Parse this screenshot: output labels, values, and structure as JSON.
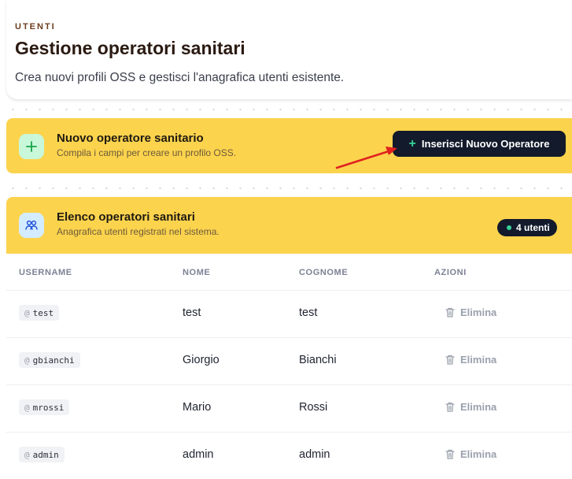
{
  "header": {
    "section_label": "UTENTI",
    "title": "Gestione operatori sanitari",
    "subtitle": "Crea nuovi profili OSS e gestisci l'anagrafica utenti esistente."
  },
  "new_operator": {
    "title": "Nuovo operatore sanitario",
    "subtitle": "Compila i campi per creare un profilo OSS.",
    "button_label": "Inserisci Nuovo Operatore"
  },
  "operators_list": {
    "title": "Elenco operatori sanitari",
    "subtitle": "Anagrafica utenti registrati nel sistema.",
    "count_label": "4 utenti",
    "columns": [
      "USERNAME",
      "NOME",
      "COGNOME",
      "AZIONI"
    ],
    "rows": [
      {
        "username": "test",
        "nome": "test",
        "cognome": "test",
        "action": "Elimina"
      },
      {
        "username": "gbianchi",
        "nome": "Giorgio",
        "cognome": "Bianchi",
        "action": "Elimina"
      },
      {
        "username": "mrossi",
        "nome": "Mario",
        "cognome": "Rossi",
        "action": "Elimina"
      },
      {
        "username": "admin",
        "nome": "admin",
        "cognome": "admin",
        "action": "Elimina"
      }
    ],
    "username_prefix": "@"
  },
  "colors": {
    "accent_yellow": "#fcd34d",
    "button_dark": "#121a2b",
    "green_accent": "#34d399",
    "annotation_arrow": "#e0221f"
  },
  "icons": {
    "new_operator": "plus-icon",
    "list": "users-icon",
    "delete": "trash-icon"
  }
}
